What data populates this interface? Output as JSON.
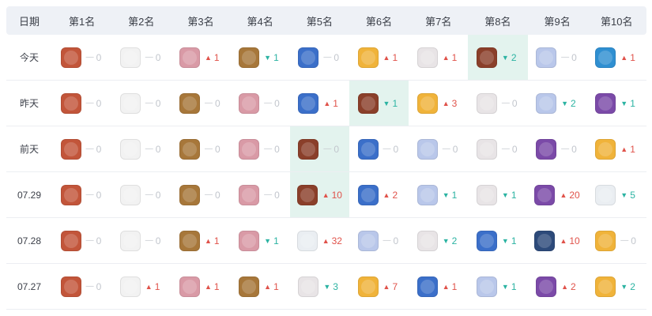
{
  "header": {
    "date_label": "日期",
    "ranks": [
      "第1名",
      "第2名",
      "第3名",
      "第4名",
      "第5名",
      "第6名",
      "第7名",
      "第8名",
      "第9名",
      "第10名"
    ]
  },
  "colors": {
    "up": "#e0524a",
    "down": "#2bb3a2",
    "same": "#c2c6cd",
    "highlight": "#e3f3ee"
  },
  "rows": [
    {
      "date": "今天",
      "cells": [
        {
          "app": "hero-red",
          "dir": "same",
          "num": "0"
        },
        {
          "app": "ink-black",
          "dir": "same",
          "num": "0"
        },
        {
          "app": "pink-girl",
          "dir": "up",
          "num": "1"
        },
        {
          "app": "gold-warrior",
          "dir": "down",
          "num": "1"
        },
        {
          "app": "blue-avatar",
          "dir": "same",
          "num": "0"
        },
        {
          "app": "yellow-fox",
          "dir": "up",
          "num": "1"
        },
        {
          "app": "white-hair",
          "dir": "up",
          "num": "1"
        },
        {
          "app": "brown-book",
          "dir": "down",
          "num": "2",
          "hl": true
        },
        {
          "app": "pastel-girl",
          "dir": "same",
          "num": "0"
        },
        {
          "app": "beach-blue",
          "dir": "up",
          "num": "1"
        }
      ]
    },
    {
      "date": "昨天",
      "cells": [
        {
          "app": "hero-red",
          "dir": "same",
          "num": "0"
        },
        {
          "app": "ink-black",
          "dir": "same",
          "num": "0"
        },
        {
          "app": "gold-warrior",
          "dir": "same",
          "num": "0"
        },
        {
          "app": "pink-girl",
          "dir": "same",
          "num": "0"
        },
        {
          "app": "blue-avatar",
          "dir": "up",
          "num": "1"
        },
        {
          "app": "brown-book",
          "dir": "down",
          "num": "1",
          "hl": true
        },
        {
          "app": "yellow-fox",
          "dir": "up",
          "num": "3"
        },
        {
          "app": "white-hair",
          "dir": "same",
          "num": "0"
        },
        {
          "app": "pastel-girl",
          "dir": "down",
          "num": "2"
        },
        {
          "app": "purple-hero",
          "dir": "down",
          "num": "1"
        }
      ]
    },
    {
      "date": "前天",
      "cells": [
        {
          "app": "hero-red",
          "dir": "same",
          "num": "0"
        },
        {
          "app": "ink-black",
          "dir": "same",
          "num": "0"
        },
        {
          "app": "gold-warrior",
          "dir": "same",
          "num": "0"
        },
        {
          "app": "pink-girl",
          "dir": "same",
          "num": "0"
        },
        {
          "app": "brown-book",
          "dir": "same",
          "num": "0",
          "hl": true
        },
        {
          "app": "blue-avatar",
          "dir": "same",
          "num": "0"
        },
        {
          "app": "pastel-girl",
          "dir": "same",
          "num": "0"
        },
        {
          "app": "white-hair",
          "dir": "same",
          "num": "0"
        },
        {
          "app": "purple-hero",
          "dir": "same",
          "num": "0"
        },
        {
          "app": "yellow-fox",
          "dir": "up",
          "num": "1"
        }
      ]
    },
    {
      "date": "07.29",
      "cells": [
        {
          "app": "hero-red",
          "dir": "same",
          "num": "0"
        },
        {
          "app": "ink-black",
          "dir": "same",
          "num": "0"
        },
        {
          "app": "gold-warrior",
          "dir": "same",
          "num": "0"
        },
        {
          "app": "pink-girl",
          "dir": "same",
          "num": "0"
        },
        {
          "app": "brown-book",
          "dir": "up",
          "num": "10",
          "hl": true
        },
        {
          "app": "blue-avatar",
          "dir": "up",
          "num": "2"
        },
        {
          "app": "pastel-girl",
          "dir": "down",
          "num": "1"
        },
        {
          "app": "white-hair",
          "dir": "down",
          "num": "1"
        },
        {
          "app": "purple-hero",
          "dir": "up",
          "num": "20"
        },
        {
          "app": "panda",
          "dir": "down",
          "num": "5"
        }
      ]
    },
    {
      "date": "07.28",
      "cells": [
        {
          "app": "hero-red",
          "dir": "same",
          "num": "0"
        },
        {
          "app": "ink-black",
          "dir": "same",
          "num": "0"
        },
        {
          "app": "gold-warrior",
          "dir": "up",
          "num": "1"
        },
        {
          "app": "pink-girl",
          "dir": "down",
          "num": "1"
        },
        {
          "app": "panda",
          "dir": "up",
          "num": "32"
        },
        {
          "app": "pastel-girl",
          "dir": "same",
          "num": "0"
        },
        {
          "app": "white-hair",
          "dir": "down",
          "num": "2"
        },
        {
          "app": "blue-avatar",
          "dir": "down",
          "num": "1"
        },
        {
          "app": "dark-blue",
          "dir": "up",
          "num": "10"
        },
        {
          "app": "yellow-fox",
          "dir": "same",
          "num": "0"
        }
      ]
    },
    {
      "date": "07.27",
      "cells": [
        {
          "app": "hero-red",
          "dir": "same",
          "num": "0"
        },
        {
          "app": "ink-black",
          "dir": "up",
          "num": "1"
        },
        {
          "app": "pink-girl",
          "dir": "up",
          "num": "1"
        },
        {
          "app": "gold-warrior",
          "dir": "up",
          "num": "1"
        },
        {
          "app": "white-hair",
          "dir": "down",
          "num": "3"
        },
        {
          "app": "yellow-fox",
          "dir": "up",
          "num": "7"
        },
        {
          "app": "blue-avatar",
          "dir": "up",
          "num": "1"
        },
        {
          "app": "pastel-girl",
          "dir": "down",
          "num": "1"
        },
        {
          "app": "purple-hero",
          "dir": "up",
          "num": "2"
        },
        {
          "app": "yellow-fox",
          "dir": "down",
          "num": "2"
        }
      ]
    }
  ],
  "app_colors": {
    "hero-red": "#c2553a",
    "ink-black": "#f2f2f2",
    "pink-girl": "#d99aa6",
    "gold-warrior": "#a7773a",
    "blue-avatar": "#3b6fc9",
    "yellow-fox": "#f0b33a",
    "white-hair": "#e8e4e6",
    "brown-book": "#8a3f2a",
    "pastel-girl": "#b9c7ea",
    "beach-blue": "#2f8fd1",
    "purple-hero": "#7b4aa8",
    "panda": "#eaeef2",
    "dark-blue": "#2d4a7a"
  }
}
